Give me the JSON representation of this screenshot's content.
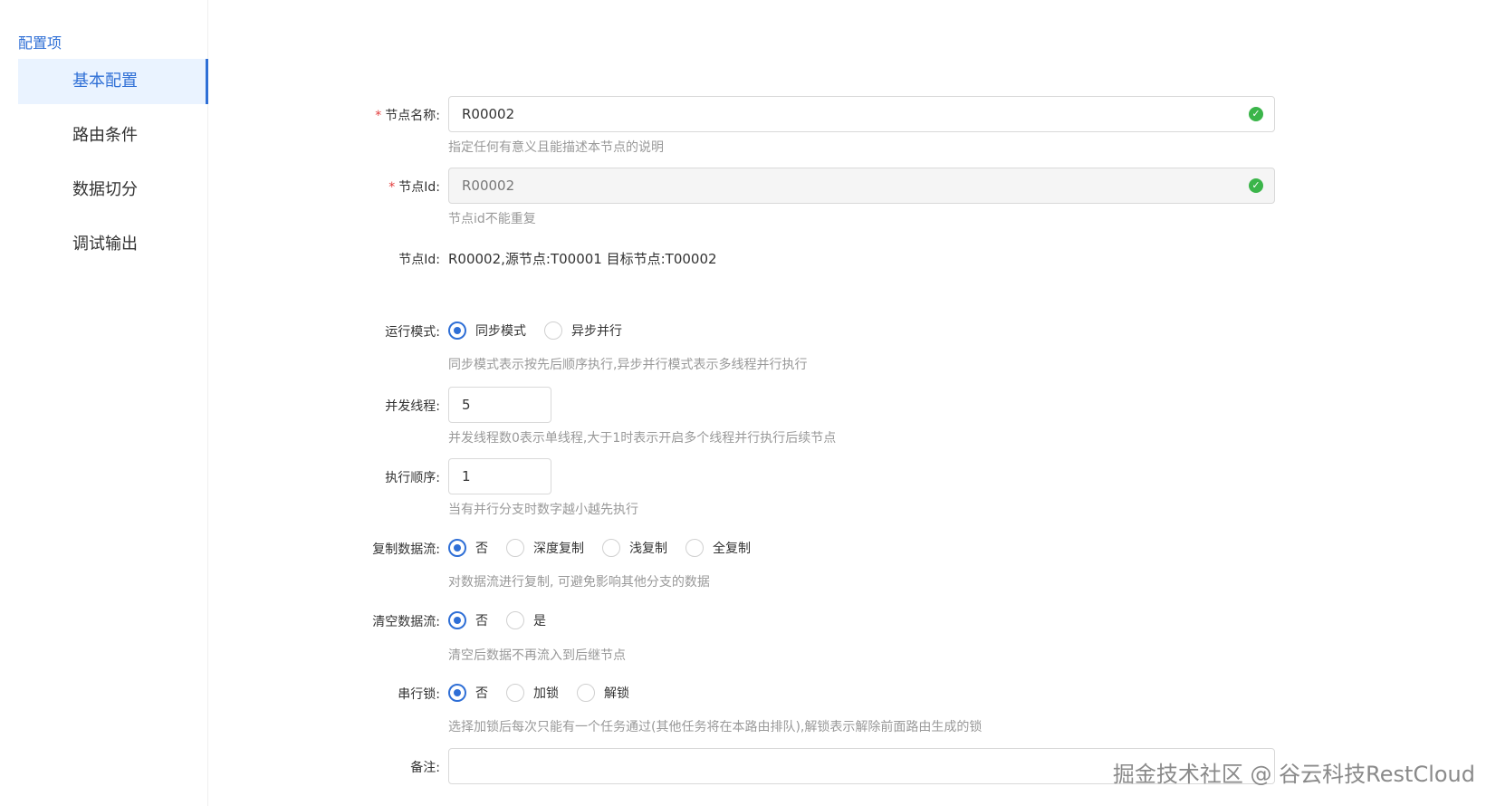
{
  "sidebar": {
    "title": "配置项",
    "items": [
      {
        "label": "基本配置"
      },
      {
        "label": "路由条件"
      },
      {
        "label": "数据切分"
      },
      {
        "label": "调试输出"
      }
    ]
  },
  "form": {
    "node_name": {
      "required_mark": "*",
      "label": "节点名称:",
      "value": "R00002",
      "help": "指定任何有意义且能描述本节点的说明"
    },
    "node_id": {
      "required_mark": "*",
      "label": "节点Id:",
      "value": "R00002",
      "help": "节点id不能重复"
    },
    "node_info": {
      "label": "节点Id:",
      "value": "R00002,源节点:T00001 目标节点:T00002"
    },
    "run_mode": {
      "label": "运行模式:",
      "options": [
        "同步模式",
        "异步并行"
      ],
      "selected": "同步模式",
      "help": "同步模式表示按先后顺序执行,异步并行模式表示多线程并行执行"
    },
    "concurrency": {
      "label": "并发线程:",
      "value": "5",
      "help": "并发线程数0表示单线程,大于1时表示开启多个线程并行执行后续节点"
    },
    "exec_order": {
      "label": "执行顺序:",
      "value": "1",
      "help": "当有并行分支时数字越小越先执行"
    },
    "copy_stream": {
      "label": "复制数据流:",
      "options": [
        "否",
        "深度复制",
        "浅复制",
        "全复制"
      ],
      "selected": "否",
      "help": "对数据流进行复制, 可避免影响其他分支的数据"
    },
    "clear_stream": {
      "label": "清空数据流:",
      "options": [
        "否",
        "是"
      ],
      "selected": "否",
      "help": "清空后数据不再流入到后继节点"
    },
    "serial_lock": {
      "label": "串行锁:",
      "options": [
        "否",
        "加锁",
        "解锁"
      ],
      "selected": "否",
      "help": "选择加锁后每次只能有一个任务通过(其他任务将在本路由排队),解锁表示解除前面路由生成的锁"
    },
    "remark": {
      "label": "备注:",
      "value": ""
    }
  },
  "watermark": "掘金技术社区 @ 谷云科技RestCloud",
  "colors": {
    "accent": "#2f6fd6",
    "success": "#3bb54a",
    "required": "#e23b3b"
  }
}
